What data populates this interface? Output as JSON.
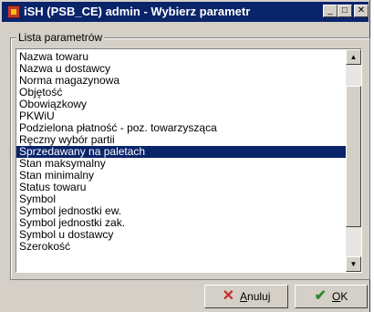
{
  "window": {
    "title": "iSH (PSB_CE) admin - Wybierz parametr",
    "controls": {
      "minimize": "_",
      "maximize": "□",
      "close": "✕"
    }
  },
  "group": {
    "label": "Lista parametrów"
  },
  "list": {
    "items": [
      "Nazwa towaru",
      "Nazwa u dostawcy",
      "Norma magazynowa",
      "Objętość",
      "Obowiązkowy",
      "PKWiU",
      "Podzielona płatność - poz. towarzysząca",
      "Ręczny wybór partii",
      "Sprzedawany na paletach",
      "Stan maksymalny",
      "Stan minimalny",
      "Status towaru",
      "Symbol",
      "Symbol jednostki ew.",
      "Symbol jednostki zak.",
      "Symbol u dostawcy",
      "Szerokość"
    ],
    "selected": "Sprzedawany na paletach"
  },
  "buttons": {
    "cancel": {
      "mnemonic": "A",
      "rest": "nuluj"
    },
    "ok": {
      "mnemonic": "O",
      "rest": "K"
    }
  },
  "icons": {
    "app": "app-icon",
    "cancel": "x-icon",
    "ok": "check-icon"
  },
  "colors": {
    "titlebar": "#0a246a",
    "selection": "#0a246a",
    "face": "#d4d0c8"
  }
}
